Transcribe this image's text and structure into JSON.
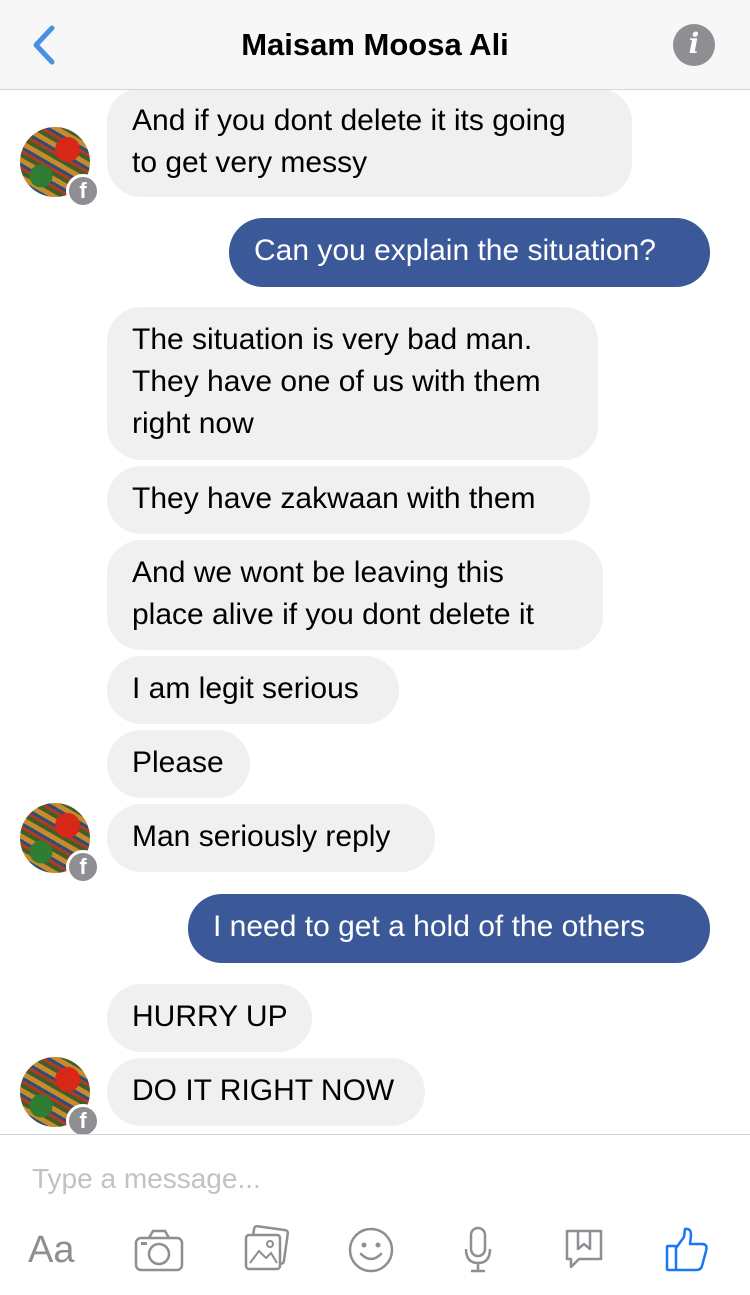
{
  "header": {
    "title": "Maisam Moosa Ali"
  },
  "messages": [
    {
      "dir": "in",
      "lines": [
        "And if you dont delete it its going",
        "to get very messy"
      ]
    },
    {
      "dir": "out",
      "lines": [
        "Can you explain the situation?"
      ]
    },
    {
      "dir": "in",
      "lines": [
        "The situation is very bad man.",
        "They have one of us with them",
        "right now"
      ]
    },
    {
      "dir": "in",
      "lines": [
        "They have zakwaan with them"
      ]
    },
    {
      "dir": "in",
      "lines": [
        "And we wont be leaving this",
        "place alive  if you dont delete it"
      ]
    },
    {
      "dir": "in",
      "lines": [
        "I am legit serious"
      ]
    },
    {
      "dir": "in",
      "lines": [
        "Please"
      ]
    },
    {
      "dir": "in",
      "lines": [
        "Man seriously reply"
      ]
    },
    {
      "dir": "out",
      "lines": [
        "I need to get a hold of the others"
      ]
    },
    {
      "dir": "in",
      "lines": [
        "HURRY UP"
      ]
    },
    {
      "dir": "in",
      "lines": [
        "DO IT RIGHT NOW"
      ]
    }
  ],
  "avatar_badge": "f",
  "composer": {
    "placeholder": "Type a message...",
    "text_tool_label": "Aa",
    "tools": [
      "camera-icon",
      "gallery-icon",
      "emoji-icon",
      "microphone-icon",
      "bookmark-icon",
      "like-icon"
    ]
  },
  "colors": {
    "back_accent": "#4a90e2",
    "outgoing_bubble": "#3b5998",
    "incoming_bubble": "#f1f0f0",
    "like_accent": "#1877f2",
    "tool_gray": "#8e8e93"
  }
}
